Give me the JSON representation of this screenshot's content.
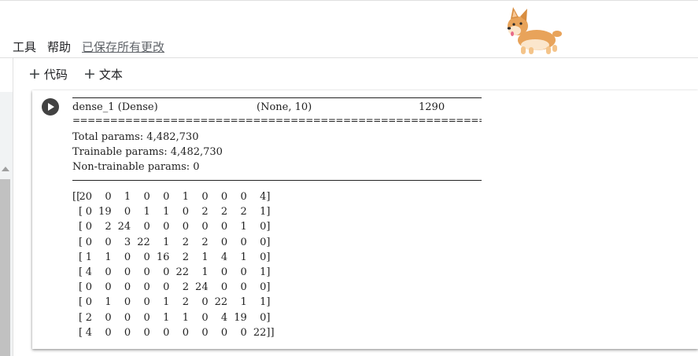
{
  "menu": {
    "items": [
      "工具",
      "帮助"
    ],
    "status": "已保存所有更改"
  },
  "toolbar": {
    "add_code_label": "代码",
    "add_text_label": "文本",
    "plus_symbol": "+"
  },
  "output": {
    "layer": {
      "name": "dense_1 (Dense)",
      "shape": "(None, 10)",
      "params": "1290"
    },
    "separator": "==================================================================",
    "total_params": "Total params: 4,482,730",
    "trainable_params": "Trainable params: 4,482,730",
    "non_trainable_params": "Non-trainable params: 0",
    "confusion_matrix": [
      [
        20,
        0,
        1,
        0,
        0,
        1,
        0,
        0,
        0,
        4
      ],
      [
        0,
        19,
        0,
        1,
        1,
        0,
        2,
        2,
        2,
        1
      ],
      [
        0,
        2,
        24,
        0,
        0,
        0,
        0,
        0,
        1,
        0
      ],
      [
        0,
        0,
        3,
        22,
        1,
        2,
        2,
        0,
        0,
        0
      ],
      [
        1,
        1,
        0,
        0,
        16,
        2,
        1,
        4,
        1,
        0
      ],
      [
        4,
        0,
        0,
        0,
        0,
        22,
        1,
        0,
        0,
        1
      ],
      [
        0,
        0,
        0,
        0,
        0,
        2,
        24,
        0,
        0,
        0
      ],
      [
        0,
        1,
        0,
        0,
        1,
        2,
        0,
        22,
        1,
        1
      ],
      [
        2,
        0,
        0,
        0,
        1,
        1,
        0,
        4,
        19,
        0
      ],
      [
        4,
        0,
        0,
        0,
        0,
        0,
        0,
        0,
        0,
        22
      ]
    ]
  },
  "colors": {
    "run_button": "#424242",
    "scrollbar": "#c1c1c1",
    "text": "#212121"
  },
  "icons": {
    "corgi": "corgi-mascot-icon",
    "run": "play-icon"
  }
}
